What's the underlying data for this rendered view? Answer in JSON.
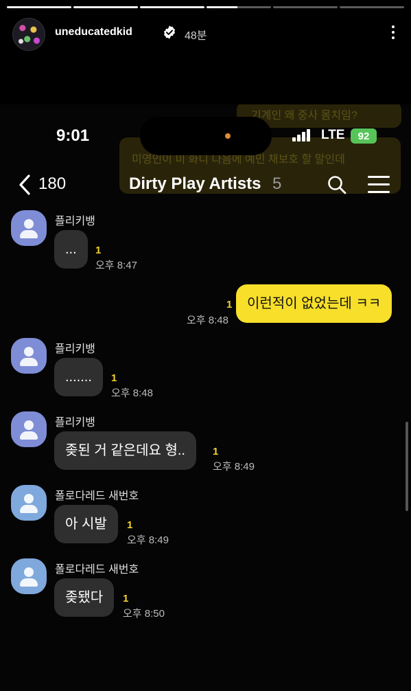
{
  "story": {
    "progress": [
      1,
      1,
      1,
      0.48,
      0,
      0
    ],
    "username": "uneducatedkid",
    "time": "48분"
  },
  "ghost": {
    "text1": "기계인 왜 중사 몸치임?",
    "text2": "미영인이 미 화디 다음에 예민 채보호 할 말인데"
  },
  "status_bar": {
    "time": "9:01",
    "network": "LTE",
    "battery": "92"
  },
  "chat_header": {
    "back_count": "180",
    "title": "Dirty Play Artists",
    "member_count": "5"
  },
  "messages": [
    {
      "sender": "플리키뱅",
      "text": "...",
      "unread": "1",
      "time": "오후 8:47",
      "mine": false
    },
    {
      "sender": "",
      "text": "이런적이 없었는데 ㅋㅋ",
      "unread": "1",
      "time": "오후 8:48",
      "mine": true
    },
    {
      "sender": "플리키뱅",
      "text": ".......",
      "unread": "1",
      "time": "오후 8:48",
      "mine": false
    },
    {
      "sender": "플리키뱅",
      "text": "좆된 거 같은데요 형..",
      "unread": "1",
      "time": "오후 8:49",
      "mine": false
    },
    {
      "sender": "폴로다레드 새번호",
      "text": "아 시발",
      "unread": "1",
      "time": "오후 8:49",
      "mine": false
    },
    {
      "sender": "폴로다레드 새번호",
      "text": "좆됐다",
      "unread": "1",
      "time": "오후 8:50",
      "mine": false
    }
  ],
  "colors": {
    "my_bubble": "#f7df2a",
    "their_bubble": "#2f2f2f",
    "unread": "#f4d22b",
    "battery": "#57c45a"
  }
}
